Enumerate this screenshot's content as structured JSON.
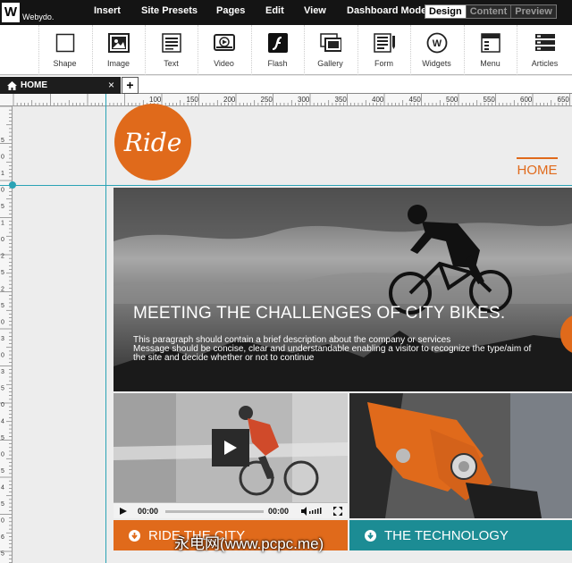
{
  "app": {
    "logo_letter": "W",
    "logo_name": "Webydo."
  },
  "menu": {
    "insert": "Insert",
    "site_presets": "Site Presets",
    "pages": "Pages",
    "edit": "Edit",
    "view": "View"
  },
  "dashboard": {
    "label": "Dashboard Mode:",
    "design": "Design",
    "content": "Content",
    "preview": "Preview"
  },
  "tools": {
    "shape": "Shape",
    "image": "Image",
    "text": "Text",
    "video": "Video",
    "flash": "Flash",
    "gallery": "Gallery",
    "form": "Form",
    "widgets": "Widgets",
    "menu": "Menu",
    "articles": "Articles"
  },
  "tab": {
    "home_label": "HOME",
    "close": "×",
    "add": "+"
  },
  "ruler": {
    "h_ticks": [
      "100",
      "150",
      "200",
      "250",
      "300",
      "350",
      "400",
      "450",
      "500",
      "550",
      "600",
      "650",
      "700"
    ],
    "v_ticks": [
      "5",
      "0",
      "1",
      "0",
      "5",
      "1",
      "0",
      "2",
      "5",
      "2",
      "5",
      "0",
      "3",
      "0",
      "3",
      "5",
      "0",
      "4",
      "5",
      "0",
      "5",
      "4",
      "5",
      "0",
      "6",
      "5",
      "0"
    ]
  },
  "site": {
    "logo_text": "Ride",
    "nav_home": "HOME",
    "hero_title": "MEETING THE CHALLENGES OF CITY BIKES.",
    "hero_text_1": "This paragraph  should contain a brief description about the company or services",
    "hero_text_2": "Message should be concise, clear and understandable enabling a visitor to recognize the type/aim of",
    "hero_text_3": "the site and decide whether or not to continue",
    "video_time_current": "00:00",
    "video_time_total": "00:00",
    "btn_ride": "RIDE THE CITY",
    "btn_tech": "THE TECHNOLOGY"
  },
  "watermark": "永电网(www.pcpc.me)",
  "colors": {
    "accent_orange": "#e06a1b",
    "accent_teal": "#1c8c94",
    "guide": "#2aa3b5",
    "topbar": "#141414"
  }
}
